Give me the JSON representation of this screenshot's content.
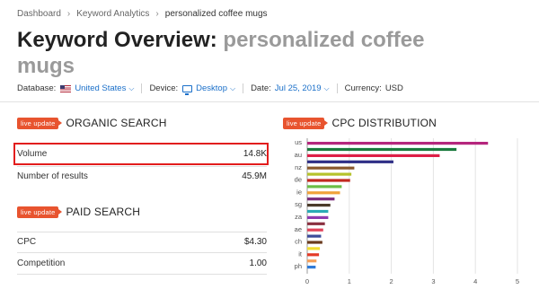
{
  "breadcrumb": [
    "Dashboard",
    "Keyword Analytics",
    "personalized coffee mugs"
  ],
  "title": {
    "prefix": "Keyword Overview:",
    "keyword": "personalized coffee mugs"
  },
  "filters": {
    "database_label": "Database:",
    "database_value": "United States",
    "device_label": "Device:",
    "device_value": "Desktop",
    "date_label": "Date:",
    "date_value": "Jul 25, 2019",
    "currency_label": "Currency:",
    "currency_value": "USD"
  },
  "badge": "live update",
  "organic": {
    "title": "ORGANIC SEARCH",
    "rows": [
      {
        "label": "Volume",
        "value": "14.8K"
      },
      {
        "label": "Number of results",
        "value": "45.9M"
      }
    ]
  },
  "paid": {
    "title": "PAID SEARCH",
    "rows": [
      {
        "label": "CPC",
        "value": "$4.30"
      },
      {
        "label": "Competition",
        "value": "1.00"
      }
    ]
  },
  "cpc": {
    "title": "CPC DISTRIBUTION"
  },
  "chart_data": {
    "type": "bar",
    "orientation": "horizontal",
    "categories": [
      "us",
      "au",
      "nz",
      "de",
      "ie",
      "sg",
      "za",
      "ae",
      "ch",
      "it",
      "ph"
    ],
    "x_ticks": [
      0,
      1,
      2,
      3,
      4,
      5
    ],
    "xlim": [
      0,
      5
    ],
    "grid": true,
    "bars": [
      {
        "value": 4.3,
        "color": "#b5267d",
        "label": "us"
      },
      {
        "value": 3.55,
        "color": "#1a7a3c",
        "label": ""
      },
      {
        "value": 3.15,
        "color": "#dd1f47",
        "label": "au"
      },
      {
        "value": 2.05,
        "color": "#2f2f86",
        "label": ""
      },
      {
        "value": 1.12,
        "color": "#8a5a2e",
        "label": "nz"
      },
      {
        "value": 1.05,
        "color": "#b5c22a",
        "label": ""
      },
      {
        "value": 1.02,
        "color": "#c2281f",
        "label": "de"
      },
      {
        "value": 0.82,
        "color": "#6bbd45",
        "label": ""
      },
      {
        "value": 0.78,
        "color": "#f0a23a",
        "label": "ie"
      },
      {
        "value": 0.65,
        "color": "#7b2b7b",
        "label": ""
      },
      {
        "value": 0.55,
        "color": "#4a3b2a",
        "label": "sg"
      },
      {
        "value": 0.5,
        "color": "#2aaab6",
        "label": ""
      },
      {
        "value": 0.5,
        "color": "#8e3ab0",
        "label": "za"
      },
      {
        "value": 0.42,
        "color": "#8a3040",
        "label": ""
      },
      {
        "value": 0.38,
        "color": "#e0425a",
        "label": "ae"
      },
      {
        "value": 0.33,
        "color": "#3c4b9a",
        "label": ""
      },
      {
        "value": 0.36,
        "color": "#6a3b1e",
        "label": "ch"
      },
      {
        "value": 0.3,
        "color": "#f2dd30",
        "label": ""
      },
      {
        "value": 0.28,
        "color": "#e43b26",
        "label": "it"
      },
      {
        "value": 0.22,
        "color": "#f5a05a",
        "label": ""
      },
      {
        "value": 0.2,
        "color": "#2f7bd8",
        "label": "ph"
      }
    ]
  }
}
